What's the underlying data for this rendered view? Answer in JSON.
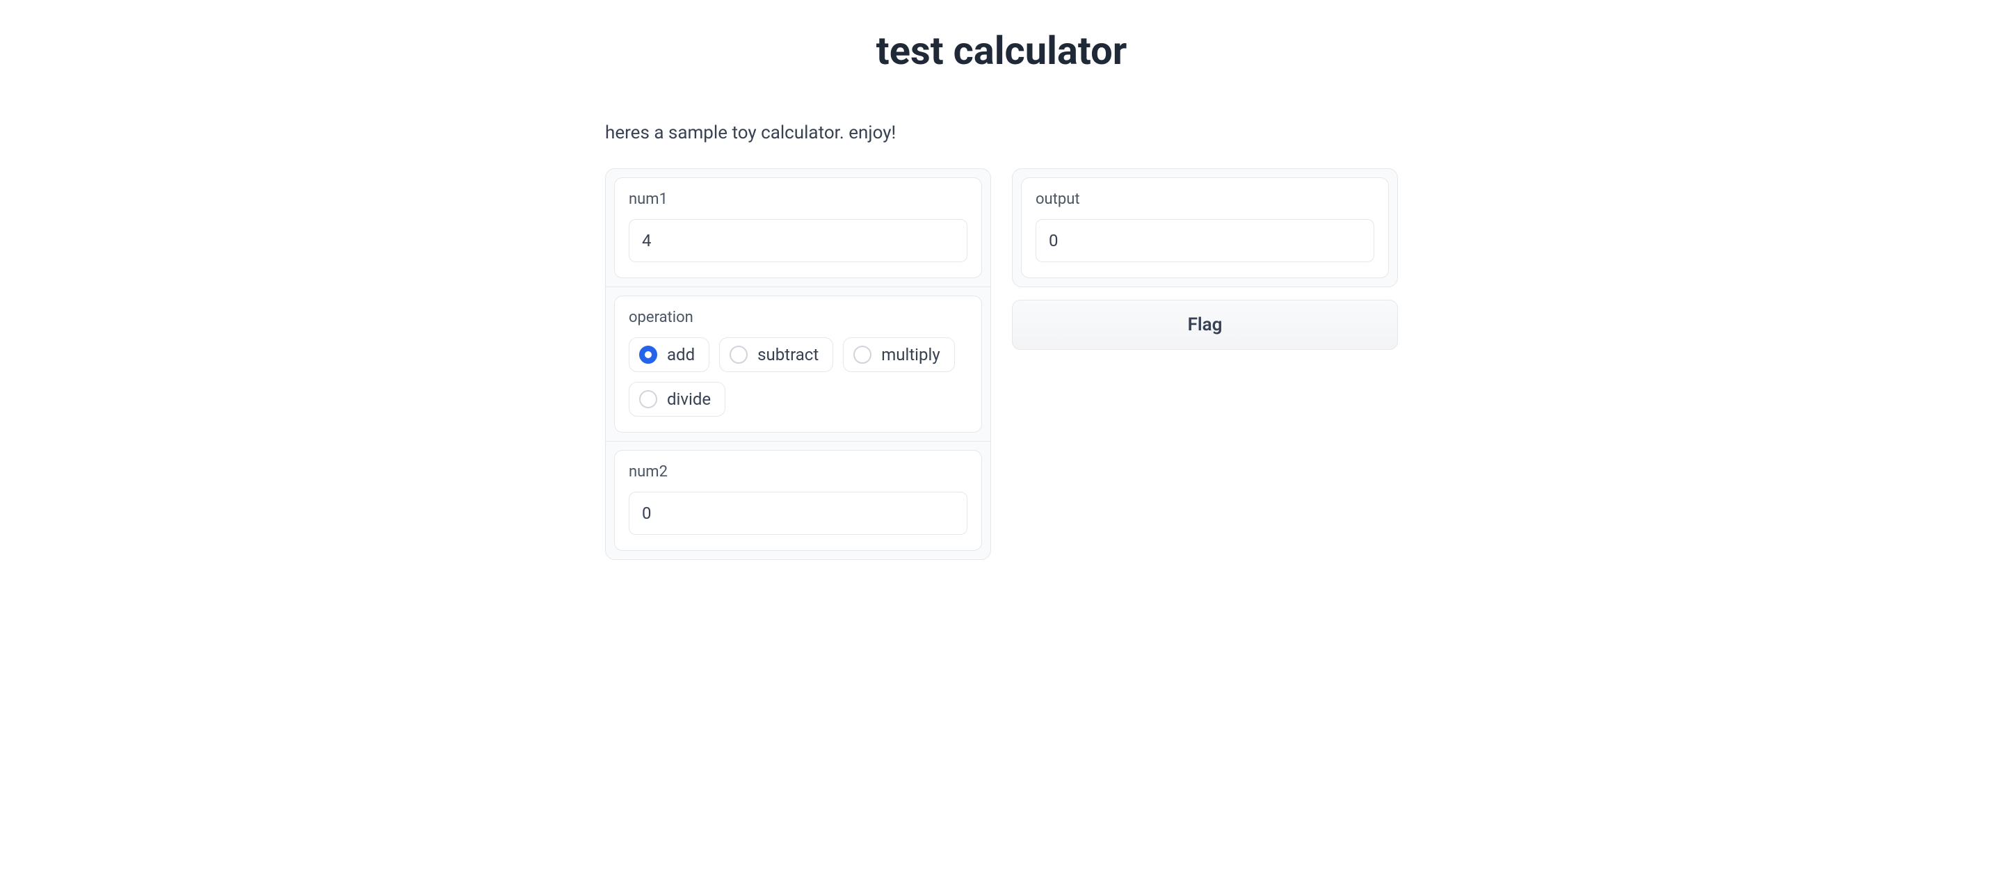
{
  "title": "test calculator",
  "description": "heres a sample toy calculator. enjoy!",
  "inputs": {
    "num1": {
      "label": "num1",
      "value": "4"
    },
    "operation": {
      "label": "operation",
      "options": [
        "add",
        "subtract",
        "multiply",
        "divide"
      ],
      "selected": "add"
    },
    "num2": {
      "label": "num2",
      "value": "0"
    }
  },
  "output": {
    "label": "output",
    "value": "0"
  },
  "flag_button": "Flag"
}
